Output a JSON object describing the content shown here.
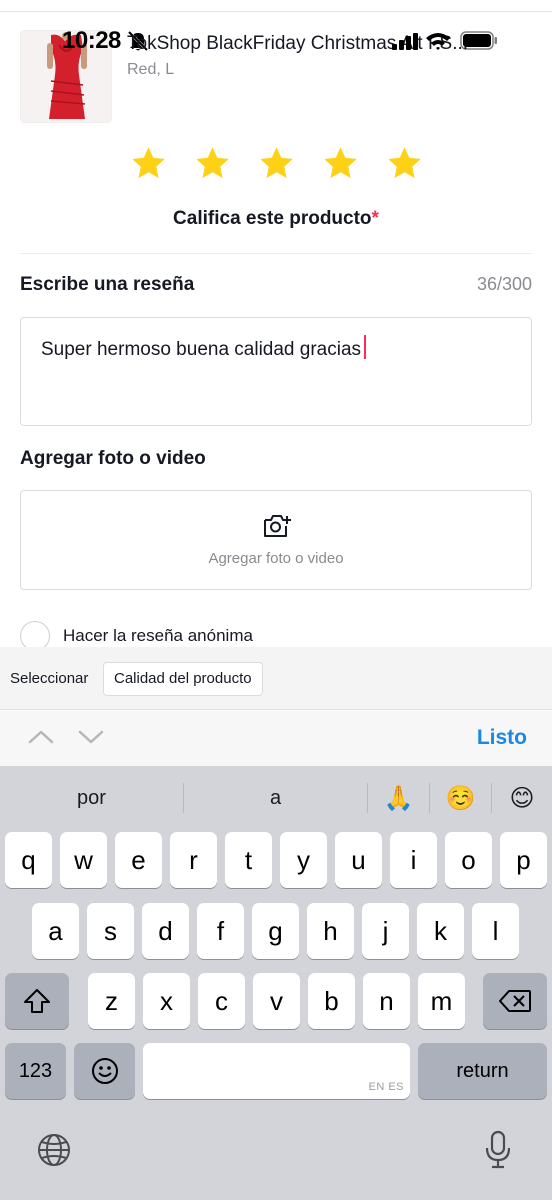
{
  "status_bar": {
    "time": "10:28"
  },
  "product": {
    "title": "TokShop BlackFriday Christmas Alt FS...",
    "variant": "Red, L"
  },
  "rating": {
    "value": 5,
    "max": 5,
    "label": "Califica este producto",
    "required_mark": "*"
  },
  "review": {
    "section_title": "Escribe una reseña",
    "counter": "36/300",
    "text": "Super hermoso buena calidad gracias"
  },
  "media": {
    "section_title": "Agregar foto o video",
    "button_label": "Agregar foto o video"
  },
  "anonymous": {
    "label": "Hacer la reseña anónima",
    "checked": false
  },
  "suggestions": {
    "label": "Seleccionar",
    "chips": [
      "Calidad del producto"
    ]
  },
  "accessory": {
    "done_label": "Listo"
  },
  "keyboard": {
    "predictions": [
      "por",
      "a",
      "🙏",
      "☺️",
      "😊"
    ],
    "rows": [
      [
        "q",
        "w",
        "e",
        "r",
        "t",
        "y",
        "u",
        "i",
        "o",
        "p"
      ],
      [
        "a",
        "s",
        "d",
        "f",
        "g",
        "h",
        "j",
        "k",
        "l"
      ],
      [
        "z",
        "x",
        "c",
        "v",
        "b",
        "n",
        "m"
      ]
    ],
    "numbers_label": "123",
    "space_hint": "EN ES",
    "return_label": "return"
  },
  "colors": {
    "star": "#fcd116",
    "accent_red": "#fe2c55",
    "done_blue": "#1a88e6",
    "keyboard_bg": "#d2d4da"
  }
}
